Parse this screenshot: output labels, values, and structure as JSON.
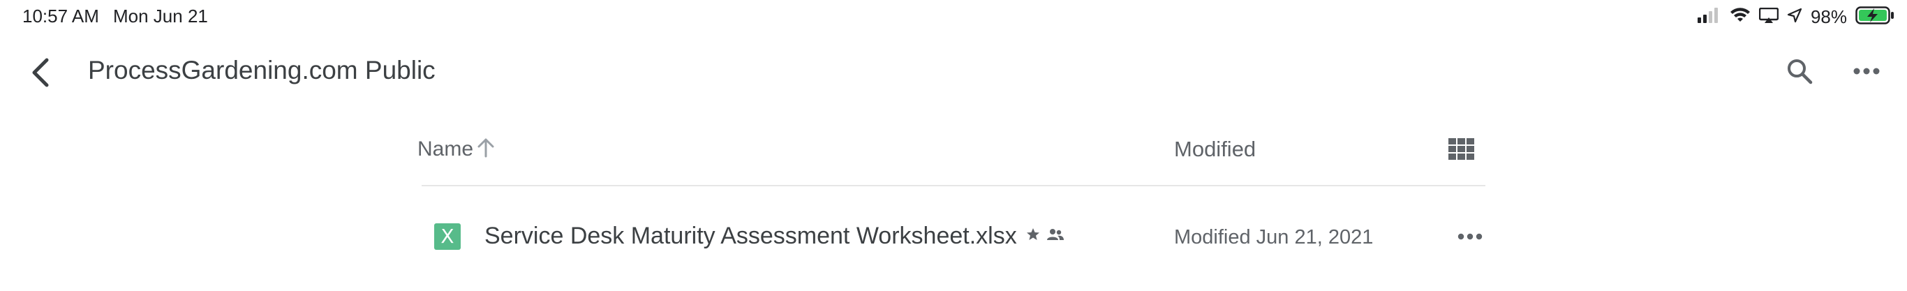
{
  "status_bar": {
    "time": "10:57 AM",
    "date": "Mon Jun 21",
    "battery_percent": "98%",
    "icons": [
      "cellular-signal-icon",
      "wifi-icon",
      "screen-mirroring-icon",
      "location-arrow-icon",
      "battery-charging-icon"
    ]
  },
  "header": {
    "title": "ProcessGardening.com Public",
    "back_icon": "chevron-left-icon",
    "search_icon": "search-icon",
    "more_icon": "more-horizontal-icon"
  },
  "columns": {
    "name_label": "Name",
    "sort_icon": "arrow-up-icon",
    "modified_label": "Modified",
    "view_toggle_icon": "grid-view-icon"
  },
  "files": [
    {
      "icon_letter": "X",
      "icon_color": "#57bb8a",
      "name": "Service Desk Maturity Assessment Worksheet.xlsx",
      "starred": true,
      "shared": true,
      "modified": "Modified Jun 21, 2021"
    }
  ],
  "colors": {
    "text_primary": "#3c4043",
    "text_secondary": "#5f6368",
    "sheets_green": "#57bb8a",
    "battery_green": "#34c759",
    "divider": "#e6e6e6"
  }
}
